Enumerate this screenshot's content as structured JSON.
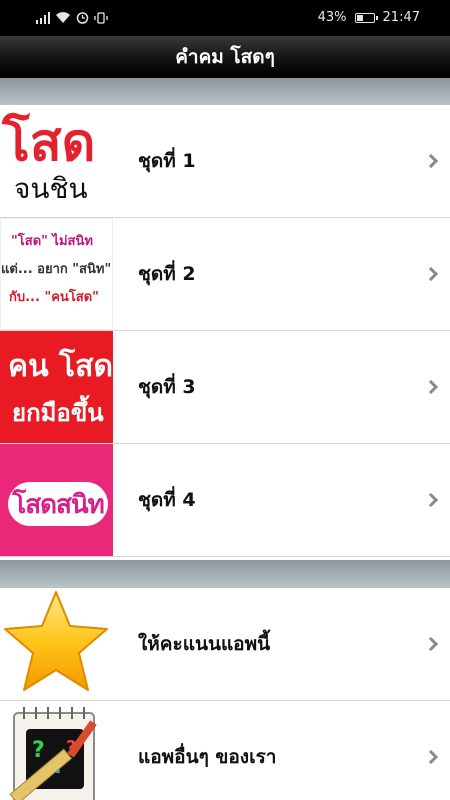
{
  "status": {
    "battery": "43%",
    "time": "21:47",
    "battery_level": 0.43
  },
  "header": {
    "title": "คำคม โสดๆ"
  },
  "sets": [
    {
      "label": "ชุดที่ 1",
      "thumb_icon": "thumbnail-image",
      "thumb_text": [
        "โสด",
        "จนชิน"
      ]
    },
    {
      "label": "ชุดที่ 2",
      "thumb_icon": "thumbnail-image",
      "thumb_text": [
        "\"โสด\" ไม่สนิท",
        "แต่... อยาก \"สนิท\"",
        "กับ... \"คนโสด\""
      ]
    },
    {
      "label": "ชุดที่ 3",
      "thumb_icon": "thumbnail-image",
      "thumb_text": [
        "คน โสด",
        "ยกมือขึ้น"
      ]
    },
    {
      "label": "ชุดที่ 4",
      "thumb_icon": "thumbnail-image",
      "thumb_text": [
        "โสดสนิท"
      ]
    }
  ],
  "extras": [
    {
      "label": "ให้คะแนนแอพนี้",
      "icon": "star-icon"
    },
    {
      "label": "แอพอื่นๆ ของเรา",
      "icon": "notebook-question-icon"
    }
  ],
  "colors": {
    "header_bg": "#000000",
    "section_band": "#a8b3b8",
    "chevron": "#8a8a8a",
    "accent_red": "#e2222d",
    "accent_pink": "#e9287a"
  }
}
